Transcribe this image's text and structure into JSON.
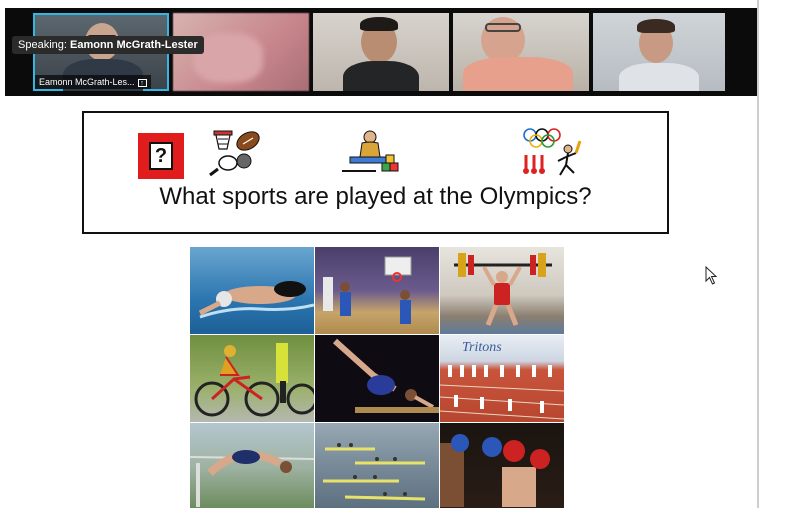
{
  "meeting": {
    "speaking_prefix": "Speaking:",
    "speaking_name": "Eamonn McGrath-Lester",
    "participants": [
      {
        "name": "Eamonn McGrath-Les..."
      },
      {
        "name": ""
      },
      {
        "name": ""
      },
      {
        "name": ""
      },
      {
        "name": ""
      }
    ],
    "accent_color": "#33b6e3"
  },
  "slide": {
    "question": "What sports are played at the Olympics?",
    "symbols": [
      "question-symbol",
      "sports-balls-symbol",
      "play-symbol",
      "olympics-symbol"
    ],
    "photos": [
      {
        "name": "swimming-photo"
      },
      {
        "name": "basketball-photo"
      },
      {
        "name": "weightlifting-photo"
      },
      {
        "name": "cycling-photo"
      },
      {
        "name": "gymnastics-photo"
      },
      {
        "name": "athletics-track-photo"
      },
      {
        "name": "high-jump-photo"
      },
      {
        "name": "rowing-photo"
      },
      {
        "name": "boxing-photo"
      }
    ]
  }
}
